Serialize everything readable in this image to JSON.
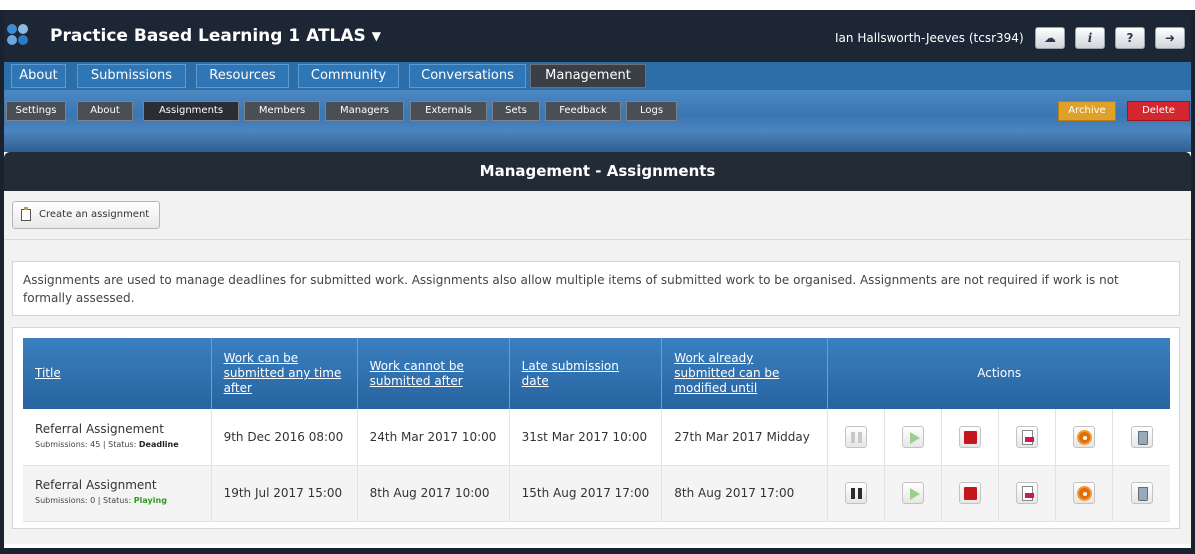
{
  "header": {
    "app_title": "Practice Based Learning 1 ATLAS",
    "user": "Ian Hallsworth-Jeeves (tcsr394)",
    "icons": [
      "cloud-icon",
      "info-icon",
      "help-icon",
      "logout-icon"
    ],
    "info_label": "i",
    "help_label": "?"
  },
  "main_nav": [
    {
      "label": "About"
    },
    {
      "label": "Submissions"
    },
    {
      "label": "Resources"
    },
    {
      "label": "Community"
    },
    {
      "label": "Conversations"
    },
    {
      "label": "Management",
      "active": true
    }
  ],
  "sub_nav": [
    {
      "label": "Settings"
    },
    {
      "label": "About"
    },
    {
      "label": "Assignments",
      "active": true
    },
    {
      "label": "Members"
    },
    {
      "label": "Managers"
    },
    {
      "label": "Externals"
    },
    {
      "label": "Sets"
    },
    {
      "label": "Feedback"
    },
    {
      "label": "Logs"
    }
  ],
  "sub_actions": {
    "archive": "Archive",
    "delete": "Delete"
  },
  "panel": {
    "title": "Management - Assignments",
    "create_button": "Create an assignment",
    "description": "Assignments are used to manage deadlines for submitted work. Assignments also allow multiple items of submitted work to be organised. Assignments are not required if work is not formally assessed."
  },
  "table": {
    "columns": [
      "Title",
      "Work can be submitted any time after",
      "Work cannot be submitted after",
      "Late submission date",
      "Work already submitted can be modified until",
      "Actions"
    ],
    "rows": [
      {
        "title": "Referral Assignement",
        "meta": "Submissions: 45 | Status: ",
        "status": "Deadline",
        "open": "9th Dec 2016 08:00",
        "close": "24th Mar 2017 10:00",
        "late": "31st Mar 2017 10:00",
        "modify": "27th Mar 2017 Midday"
      },
      {
        "title": "Referral Assignment",
        "meta": "Submissions: 0 | Status: ",
        "status": "Playing",
        "open": "19th Jul 2017 15:00",
        "close": "8th Aug 2017 10:00",
        "late": "15th Aug 2017 17:00",
        "modify": "8th Aug 2017 17:00"
      }
    ]
  },
  "colors": {
    "topbar": "#1c2634",
    "nav_blue": "#2d6ea8",
    "archive": "#e0a12a",
    "delete": "#d42630",
    "status_playing": "#2e9d1e"
  }
}
